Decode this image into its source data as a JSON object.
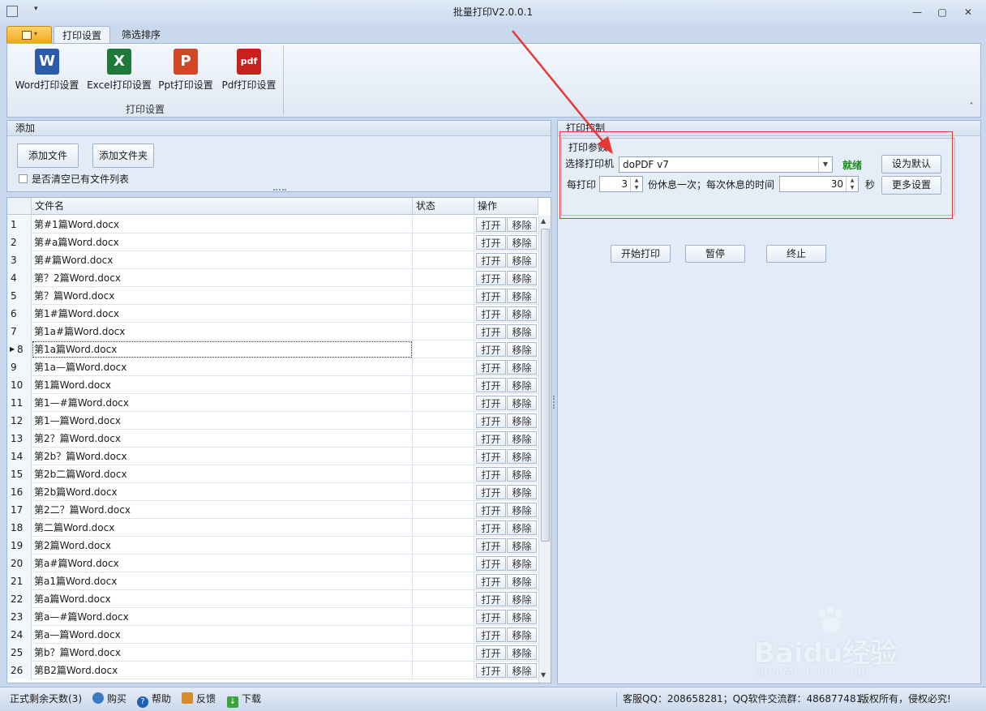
{
  "window": {
    "title": "批量打印V2.0.0.1",
    "minimize_glyph": "—",
    "restore_glyph": "▢",
    "close_glyph": "✕"
  },
  "ribbon": {
    "tabs": [
      {
        "label": "打印设置",
        "active": true
      },
      {
        "label": "筛选排序",
        "active": false
      }
    ],
    "buttons": [
      {
        "label": "Word打印设置",
        "icon": "word-icon",
        "glyph": "W",
        "color": "#2b5caa"
      },
      {
        "label": "Excel打印设置",
        "icon": "excel-icon",
        "glyph": "X",
        "color": "#1f7a3a"
      },
      {
        "label": "Ppt打印设置",
        "icon": "powerpoint-icon",
        "glyph": "P",
        "color": "#d24726"
      },
      {
        "label": "Pdf打印设置",
        "icon": "pdf-icon",
        "glyph": "pdf",
        "color": "#c8201e"
      }
    ],
    "group_label": "打印设置",
    "collapse_glyph": "˄"
  },
  "add_panel": {
    "title": "添加",
    "add_file_label": "添加文件",
    "add_folder_label": "添加文件夹",
    "clear_checkbox_label": "是否清空已有文件列表",
    "clear_checked": false
  },
  "grid": {
    "columns": [
      "文件名",
      "状态",
      "操作"
    ],
    "open_label": "打开",
    "remove_label": "移除",
    "current_row": 8,
    "rows": [
      {
        "n": "1",
        "name": "第#1篇Word.docx"
      },
      {
        "n": "2",
        "name": "第#a篇Word.docx"
      },
      {
        "n": "3",
        "name": "第#篇Word.docx"
      },
      {
        "n": "4",
        "name": "第？2篇Word.docx"
      },
      {
        "n": "5",
        "name": "第？篇Word.docx"
      },
      {
        "n": "6",
        "name": "第1#篇Word.docx"
      },
      {
        "n": "7",
        "name": "第1a#篇Word.docx"
      },
      {
        "n": "8",
        "name": "第1a篇Word.docx"
      },
      {
        "n": "9",
        "name": "第1a—篇Word.docx"
      },
      {
        "n": "10",
        "name": "第1篇Word.docx"
      },
      {
        "n": "11",
        "name": "第1—#篇Word.docx"
      },
      {
        "n": "12",
        "name": "第1—篇Word.docx"
      },
      {
        "n": "13",
        "name": "第2？篇Word.docx"
      },
      {
        "n": "14",
        "name": "第2b？篇Word.docx"
      },
      {
        "n": "15",
        "name": "第2b二篇Word.docx"
      },
      {
        "n": "16",
        "name": "第2b篇Word.docx"
      },
      {
        "n": "17",
        "name": "第2二？篇Word.docx"
      },
      {
        "n": "18",
        "name": "第二篇Word.docx"
      },
      {
        "n": "19",
        "name": "第2篇Word.docx"
      },
      {
        "n": "20",
        "name": "第a#篇Word.docx"
      },
      {
        "n": "21",
        "name": "第a1篇Word.docx"
      },
      {
        "n": "22",
        "name": "第a篇Word.docx"
      },
      {
        "n": "23",
        "name": "第a—#篇Word.docx"
      },
      {
        "n": "24",
        "name": "第a—篇Word.docx"
      },
      {
        "n": "25",
        "name": "第b？篇Word.docx"
      },
      {
        "n": "26",
        "name": "第B2篇Word.docx"
      }
    ]
  },
  "print_control": {
    "title": "打印控制",
    "params_title": "打印参数",
    "printer_label": "选择打印机",
    "printer_value": "doPDF v7",
    "printer_status": "就绪",
    "set_default_label": "设为默认",
    "per_print_label": "每打印",
    "copies_value": "3",
    "rest_text": "份休息一次；每次休息的时间",
    "rest_seconds": "30",
    "seconds_unit": "秒",
    "more_settings_label": "更多设置",
    "start_label": "开始打印",
    "pause_label": "暂停",
    "stop_label": "终止"
  },
  "statusbar": {
    "remaining_days": "正式剩余天数(3)",
    "buy_label": "购买",
    "help_label": "帮助",
    "feedback_label": "反馈",
    "download_label": "下载",
    "contact": "客服QQ：208658281；QQ软件交流群：486877481",
    "copyright": "版权所有，侵权必究!"
  },
  "watermark": {
    "text": "Baidu经验",
    "url": "jingyan.baidu.com"
  },
  "colors": {
    "accent": "#2b5caa",
    "status_ready": "#1a8a1a",
    "annotation_red": "#e53935"
  }
}
